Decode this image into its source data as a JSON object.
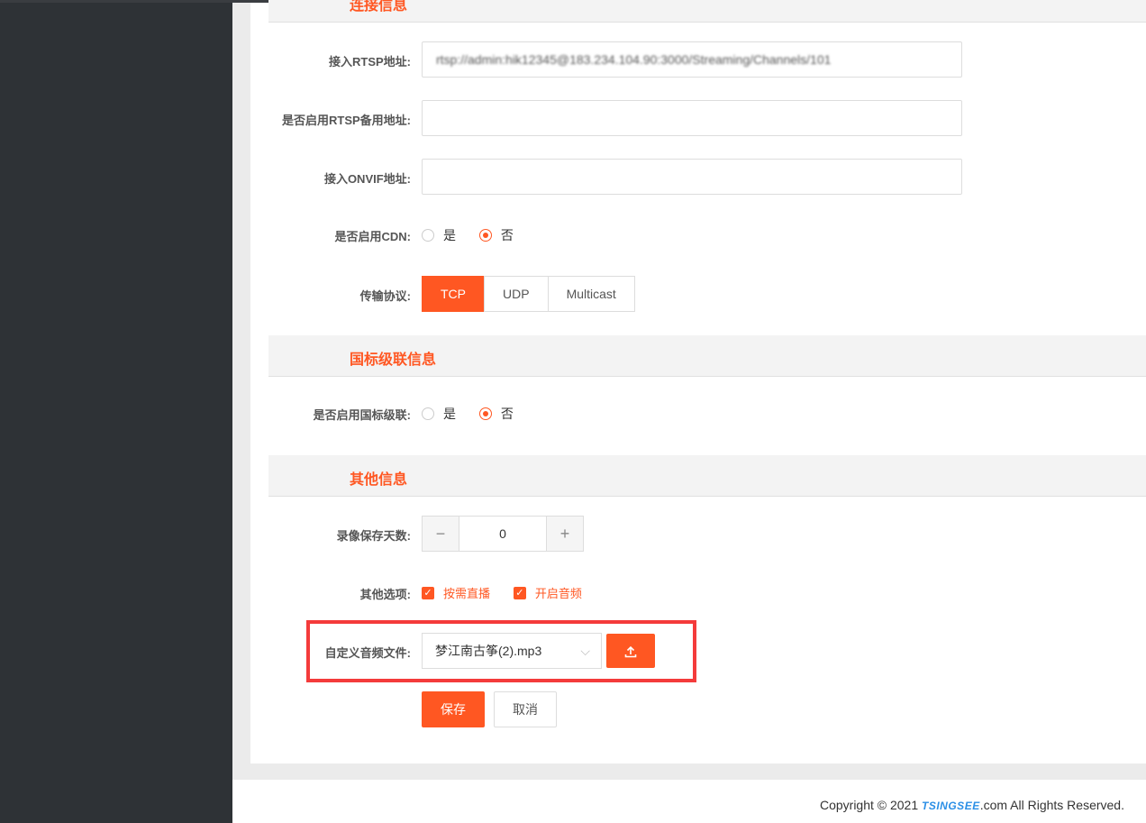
{
  "sections": {
    "connection": "连接信息",
    "gb_cascade": "国标级联信息",
    "other": "其他信息"
  },
  "fields": {
    "rtsp_label": "接入RTSP地址:",
    "rtsp_value": "rtsp://admin:hik12345@183.234.104.90:3000/Streaming/Channels/101",
    "rtsp_backup_label": "是否启用RTSP备用地址:",
    "rtsp_backup_value": "",
    "onvif_label": "接入ONVIF地址:",
    "onvif_value": "",
    "cdn_label": "是否启用CDN:",
    "cdn_options": [
      "是",
      "否"
    ],
    "cdn_selected": "否",
    "protocol_label": "传输协议:",
    "protocol_options": [
      "TCP",
      "UDP",
      "Multicast"
    ],
    "protocol_selected": "TCP",
    "gb_label": "是否启用国标级联:",
    "gb_options": [
      "是",
      "否"
    ],
    "gb_selected": "否",
    "record_days_label": "录像保存天数:",
    "record_days_value": "0",
    "record_minus": "−",
    "record_plus": "+",
    "other_options_label": "其他选项:",
    "other_options": [
      "按需直播",
      "开启音频"
    ],
    "audio_file_label": "自定义音频文件:",
    "audio_file_value": "梦江南古筝(2).mp3",
    "upload_icon": "upload-icon"
  },
  "buttons": {
    "save": "保存",
    "cancel": "取消"
  },
  "footer": {
    "prefix": "Copyright © 2021 ",
    "logo": "TSINGSEE",
    "suffix": ".com All Rights Reserved."
  },
  "colors": {
    "accent": "#ff5722",
    "highlight": "#f43b3b"
  }
}
